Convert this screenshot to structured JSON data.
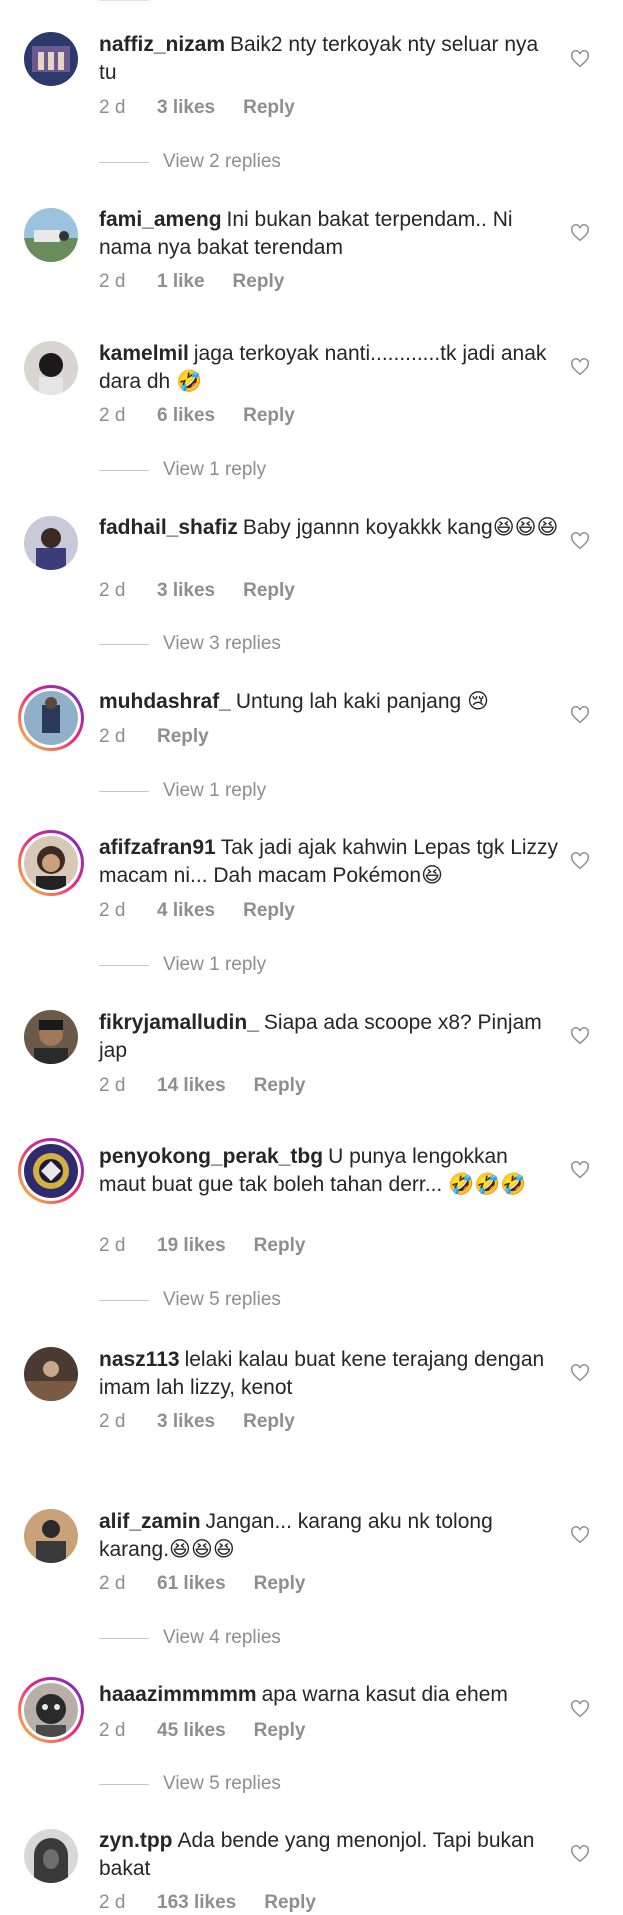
{
  "comments": [
    {
      "username": "naffiz_nizam",
      "text": "Baik2 nty terkoyak nty seluar nya tu",
      "time": "2 d",
      "likes": "3 likes",
      "reply": "Reply",
      "view_replies": "View 2 replies",
      "avatar_color": "#2b3a6b",
      "story_ring": false
    },
    {
      "username": "fami_ameng",
      "text": "Ini bukan bakat terpendam.. Ni nama nya bakat terendam",
      "time": "2 d",
      "likes": "1 like",
      "reply": "Reply",
      "view_replies": "",
      "avatar_color": "#7fa8c9",
      "story_ring": false
    },
    {
      "username": "kamelmil",
      "text": "jaga terkoyak nanti............tk jadi anak dara dh",
      "emoji": "🤣",
      "time": "2 d",
      "likes": "6 likes",
      "reply": "Reply",
      "view_replies": "View 1 reply",
      "avatar_color": "#d9d6d2",
      "story_ring": false
    },
    {
      "username": "fadhail_shafiz",
      "text": "Baby jgannn koyakkk kang",
      "emoji": "😆😆😆",
      "time": "2 d",
      "likes": "3 likes",
      "reply": "Reply",
      "view_replies": "View 3 replies",
      "avatar_color": "#3a3d7a",
      "story_ring": false
    },
    {
      "username": "muhdashraf_",
      "text": "Untung lah kaki panjang",
      "emoji": "😢",
      "time": "2 d",
      "likes": "",
      "reply": "Reply",
      "view_replies": "View 1 reply",
      "avatar_color": "#8fb0c8",
      "story_ring": true
    },
    {
      "username": "afifzafran91",
      "text": "Tak jadi ajak kahwin Lepas tgk Lizzy macam ni... Dah macam Pokémon",
      "emoji": "😆",
      "time": "2 d",
      "likes": "4 likes",
      "reply": "Reply",
      "view_replies": "View 1 reply",
      "avatar_color": "#3b2b22",
      "story_ring": true
    },
    {
      "username": "fikryjamalludin_",
      "text": "Siapa ada scoope x8? Pinjam jap",
      "time": "2 d",
      "likes": "14 likes",
      "reply": "Reply",
      "view_replies": "",
      "avatar_color": "#6b5a4a",
      "story_ring": false
    },
    {
      "username": "penyokong_perak_tbg",
      "text": "U punya lengokkan maut buat gue tak boleh tahan derr...",
      "emoji": "🤣🤣🤣",
      "time": "2 d",
      "likes": "19 likes",
      "reply": "Reply",
      "view_replies": "View 5 replies",
      "avatar_color": "#2d2a6e",
      "story_ring": true
    },
    {
      "username": "nasz113",
      "text": "lelaki kalau buat kene terajang dengan imam lah lizzy, kenot",
      "time": "2 d",
      "likes": "3 likes",
      "reply": "Reply",
      "view_replies": "",
      "avatar_color": "#4a3a32",
      "story_ring": false
    },
    {
      "username": "alif_zamin",
      "text": "Jangan... karang aku nk tolong karang.",
      "emoji": "😆😆😆",
      "time": "2 d",
      "likes": "61 likes",
      "reply": "Reply",
      "view_replies": "View 4 replies",
      "avatar_color": "#c9a27a",
      "story_ring": false
    },
    {
      "username": "haaazimmmmm",
      "text": "apa warna kasut dia ehem",
      "time": "2 d",
      "likes": "45 likes",
      "reply": "Reply",
      "view_replies": "View 5 replies",
      "avatar_color": "#3a3a3a",
      "story_ring": true
    },
    {
      "username": "zyn.tpp",
      "text": "Ada bende yang menonjol. Tapi bukan bakat",
      "time": "2 d",
      "likes": "163 likes",
      "reply": "Reply",
      "view_replies": "",
      "avatar_color": "#6e6e6e",
      "story_ring": false
    }
  ],
  "colors": {
    "text": "#262626",
    "muted": "#8e8e8e",
    "divider": "#c7c7c7"
  },
  "icons": {
    "like": "heart-outline-icon"
  }
}
